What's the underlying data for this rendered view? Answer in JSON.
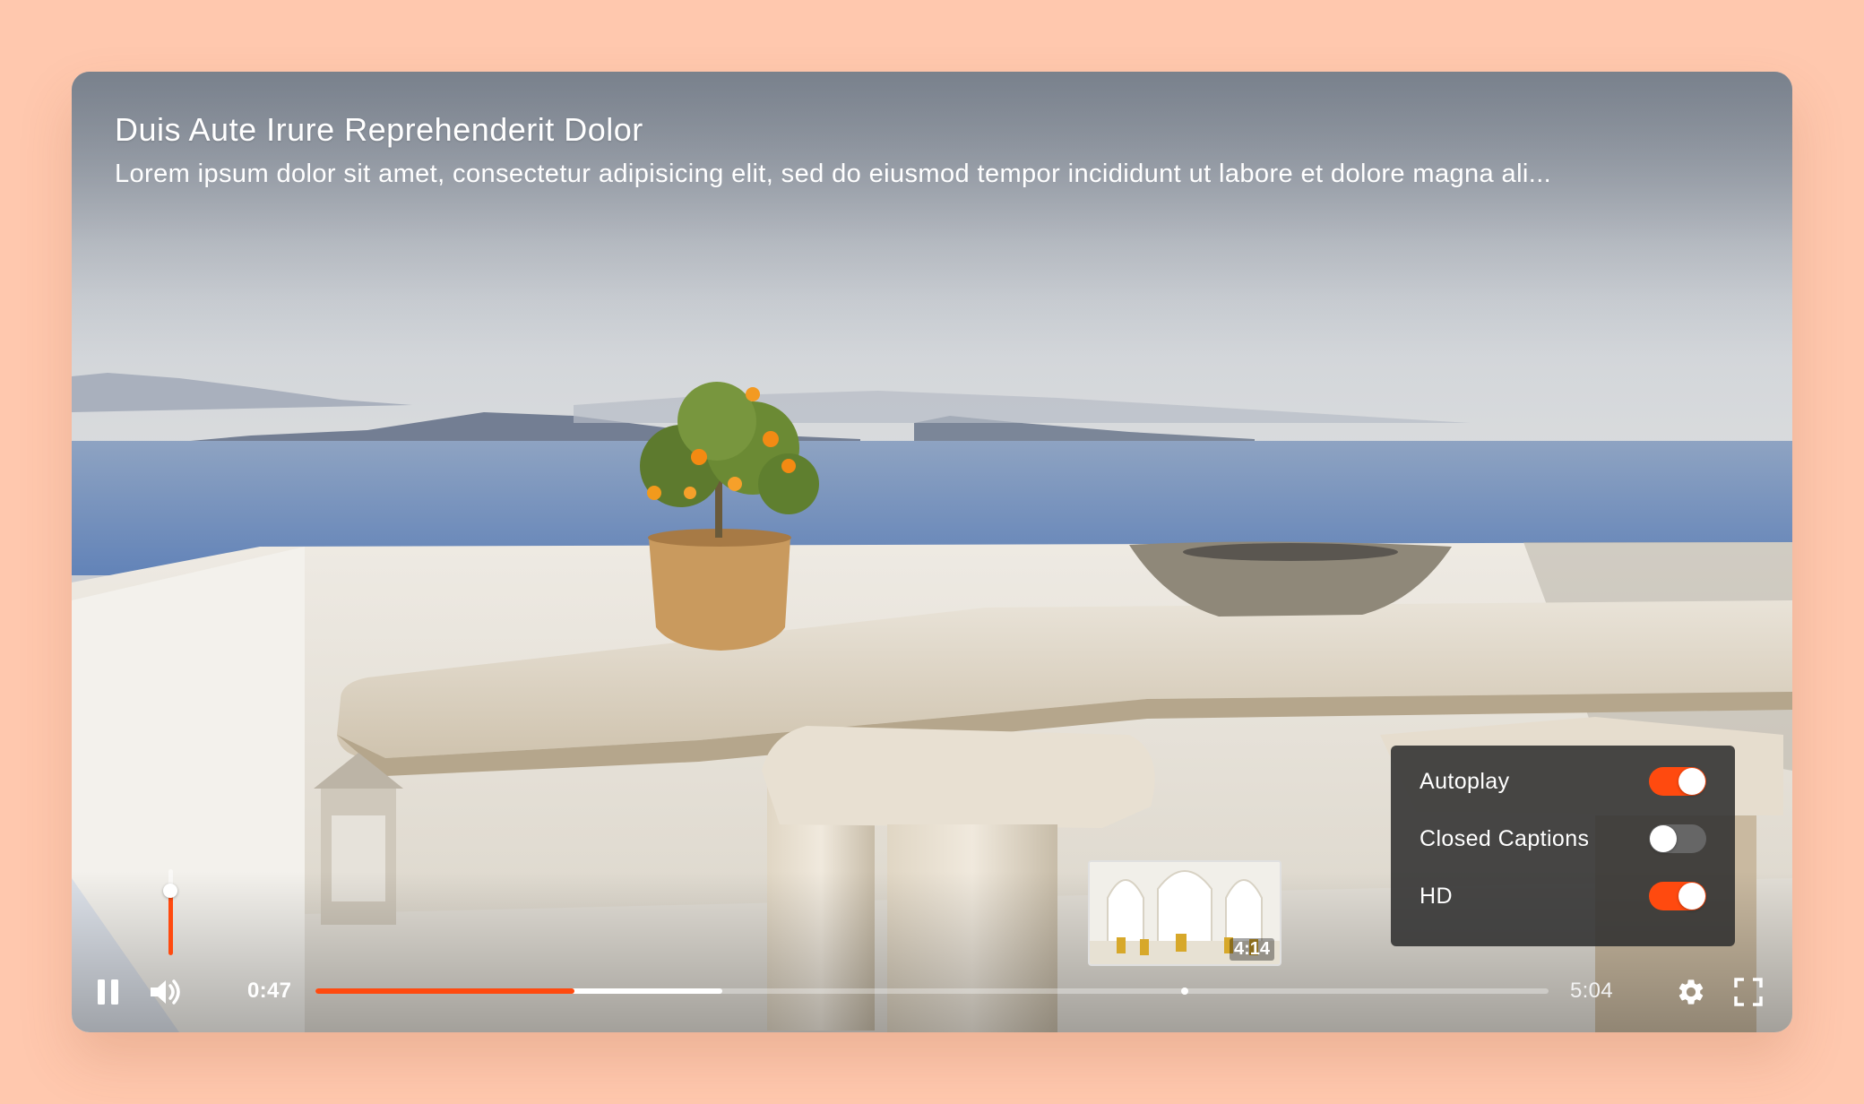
{
  "video": {
    "title": "Duis Aute Irure Reprehenderit Dolor",
    "description": "Lorem ipsum dolor sit amet, consectetur adipisicing elit, sed do eiusmod tempor incididunt ut labore et dolore magna ali..."
  },
  "settings": {
    "items": [
      {
        "label": "Autoplay",
        "enabled": true
      },
      {
        "label": "Closed Captions",
        "enabled": false
      },
      {
        "label": "HD",
        "enabled": true
      }
    ]
  },
  "preview": {
    "time": "4:14"
  },
  "playback": {
    "current_time": "0:47",
    "total_time": "5:04",
    "played_fraction": 0.21,
    "buffered_fraction": 0.33,
    "hover_fraction": 0.705,
    "volume_fraction": 0.75,
    "state": "playing"
  },
  "colors": {
    "accent": "#ff4a0f",
    "background": "#ffc8ae",
    "panel": "#303030"
  },
  "icons": {
    "play_pause": "pause-icon",
    "volume": "volume-icon",
    "settings": "gear-icon",
    "fullscreen": "fullscreen-icon"
  }
}
